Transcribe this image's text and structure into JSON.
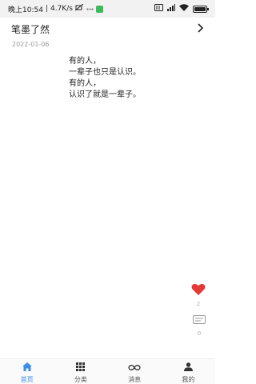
{
  "status_bar": {
    "time_text": "晚上10:54",
    "speed_text": "4.7K/s",
    "battery_text": "100",
    "battery_level": 1.0
  },
  "header": {
    "title": "笔墨了然"
  },
  "post": {
    "date": "2022-01-06",
    "lines": [
      "有的人，",
      "一辈子也只是认识。",
      "有的人，",
      "认识了就是一辈子。"
    ]
  },
  "actions": {
    "like_count": "2",
    "comment_count": "0"
  },
  "colors": {
    "accent": "#3a8ee6",
    "like": "#e53935"
  },
  "nav": {
    "items": [
      {
        "label": "首页",
        "icon": "home-icon",
        "active": true
      },
      {
        "label": "分类",
        "icon": "grid-icon",
        "active": false
      },
      {
        "label": "消息",
        "icon": "infinity-icon",
        "active": false
      },
      {
        "label": "我的",
        "icon": "person-icon",
        "active": false
      }
    ]
  }
}
